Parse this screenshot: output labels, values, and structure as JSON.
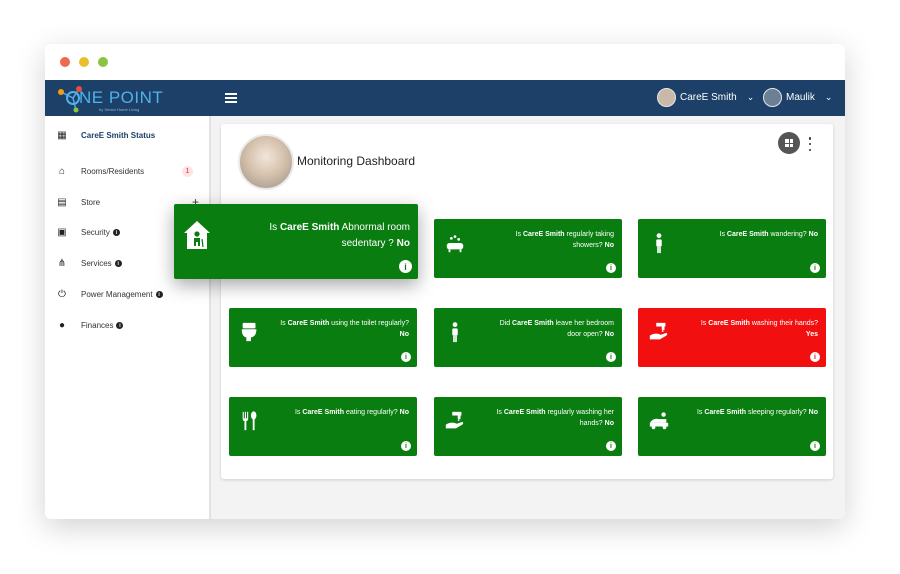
{
  "window": {
    "controls": [
      {
        "name": "close",
        "color": "#ec6a4d"
      },
      {
        "name": "minimize",
        "color": "#e9bf2e"
      },
      {
        "name": "maximize",
        "color": "#8cc43f"
      }
    ]
  },
  "topbar": {
    "logo_text": "NE POINT",
    "logo_subtext": "by Senior Home Living",
    "bg_color": "#1c4068",
    "users": [
      {
        "name": "CareE Smith"
      },
      {
        "name": "Maulik"
      }
    ]
  },
  "sidebar": {
    "items": [
      {
        "label": "CareE Smith Status",
        "icon": "dashboard-icon",
        "active": true
      },
      {
        "label": "Rooms/Residents",
        "icon": "home-icon",
        "badge": "1"
      },
      {
        "label": "Store",
        "icon": "store-icon",
        "extra": "+"
      },
      {
        "label": "Security",
        "icon": "lock-icon",
        "info": true
      },
      {
        "label": "Services",
        "icon": "services-icon",
        "info": true
      },
      {
        "label": "Power Management",
        "icon": "power-icon",
        "info": true
      },
      {
        "label": "Finances",
        "icon": "dollar-icon",
        "info": true
      }
    ]
  },
  "main": {
    "title": "Monitoring Dashboard",
    "colors": {
      "ok": "#0a7d10",
      "alert": "#f10f0f"
    },
    "cards": [
      {
        "icon": "shower-icon",
        "pre": "Is",
        "name": "CareE Smith",
        "text": "regularly taking showers?",
        "answer": "No",
        "status": "ok"
      },
      {
        "icon": "person-icon",
        "pre": "Is",
        "name": "CareE Smith",
        "text": "wandering?",
        "answer": "No",
        "status": "ok"
      },
      {
        "icon": "toilet-icon",
        "pre": "Is",
        "name": "CareE Smith",
        "text": "using the toilet regularly?",
        "answer": "No",
        "status": "ok"
      },
      {
        "icon": "door-person-icon",
        "pre": "Did",
        "name": "CareE Smith",
        "text": "leave her bedroom door open?",
        "answer": "No",
        "status": "ok"
      },
      {
        "icon": "hand-wash-icon",
        "pre": "Is",
        "name": "CareE Smith",
        "text": "washing their hands?",
        "answer": "Yes",
        "status": "alert"
      },
      {
        "icon": "fork-spoon-icon",
        "pre": "Is",
        "name": "CareE Smith",
        "text": "eating regularly?",
        "answer": "No",
        "status": "ok"
      },
      {
        "icon": "hand-wash-icon",
        "pre": "Is",
        "name": "CareE Smith",
        "text": "regularly washing her hands?",
        "answer": "No",
        "status": "ok"
      },
      {
        "icon": "sleep-icon",
        "pre": "Is",
        "name": "CareE Smith",
        "text": "sleeping regularly?",
        "answer": "No",
        "status": "ok"
      }
    ],
    "popup": {
      "icon": "house-person-icon",
      "pre": "Is",
      "name": "CareE Smith",
      "text": "Abnormal room sedentary ?",
      "answer": "No",
      "status": "ok"
    }
  }
}
